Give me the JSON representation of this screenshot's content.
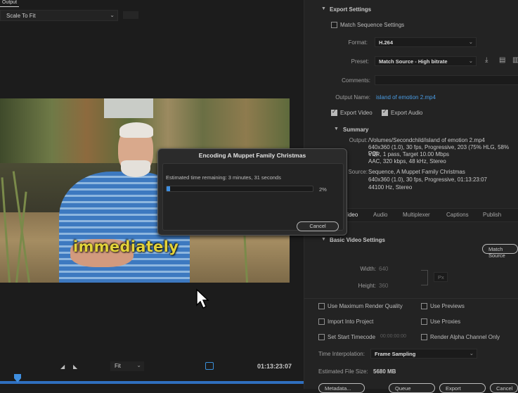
{
  "output_tab": "Output",
  "monitor": {
    "scale_mode": "Scale To Fit",
    "subtitle": "immediately",
    "fit": "Fit",
    "timecode": "01:13:23:07"
  },
  "export": {
    "section_title": "Export Settings",
    "match_sequence_label": "Match Sequence Settings",
    "format_label": "Format:",
    "format_value": "H.264",
    "preset_label": "Preset:",
    "preset_value": "Match Source - High bitrate",
    "comments_label": "Comments:",
    "output_name_label": "Output Name:",
    "output_name_value": "island of emotion 2.mp4",
    "export_video_label": "Export Video",
    "export_audio_label": "Export Audio",
    "summary_title": "Summary",
    "output_key": "Output:",
    "output_lines": [
      "/Volumes/Secondchild/island of emotion 2.mp4",
      "640x360 (1.0), 30 fps, Progressive, 203 (75% HLG, 58% PQ)",
      "VBR, 1 pass, Target 10.00 Mbps",
      "AAC, 320 kbps, 48 kHz, Stereo"
    ],
    "source_key": "Source:",
    "source_lines": [
      "Sequence, A Muppet Family Christmas",
      "640x360 (1.0), 30 fps, Progressive, 01:13:23:07",
      "44100 Hz, Stereo"
    ],
    "tabs": [
      "Video",
      "Audio",
      "Multiplexer",
      "Captions",
      "Publish"
    ],
    "basic_video_title": "Basic Video Settings",
    "match_source_btn": "Match Source",
    "width_label": "Width:",
    "width_value": "640",
    "height_label": "Height:",
    "height_value": "360",
    "unit_value": "Px",
    "opts": {
      "max_render_quality": "Use Maximum Render Quality",
      "use_previews": "Use Previews",
      "import_into_project": "Import Into Project",
      "use_proxies": "Use Proxies",
      "set_start_timecode": "Set Start Timecode",
      "start_timecode_value": "00:00:00:00",
      "render_alpha_only": "Render Alpha Channel Only"
    },
    "time_interp_label": "Time Interpolation:",
    "time_interp_value": "Frame Sampling",
    "file_size_label": "Estimated File Size:",
    "file_size_value": "5680 MB",
    "bottom_buttons": [
      "Metadata...",
      "Queue",
      "Export",
      "Cancel"
    ]
  },
  "dialog": {
    "title": "Encoding A Muppet Family Christmas",
    "estimate": "Estimated time remaining: 3 minutes, 31 seconds",
    "progress_percent": 2,
    "percent_text": "2%",
    "cancel_label": "Cancel"
  },
  "colors": {
    "accent_blue": "#3f8fe0",
    "link_blue": "#4a9de5",
    "subtitle_yellow": "#e2d23a"
  }
}
